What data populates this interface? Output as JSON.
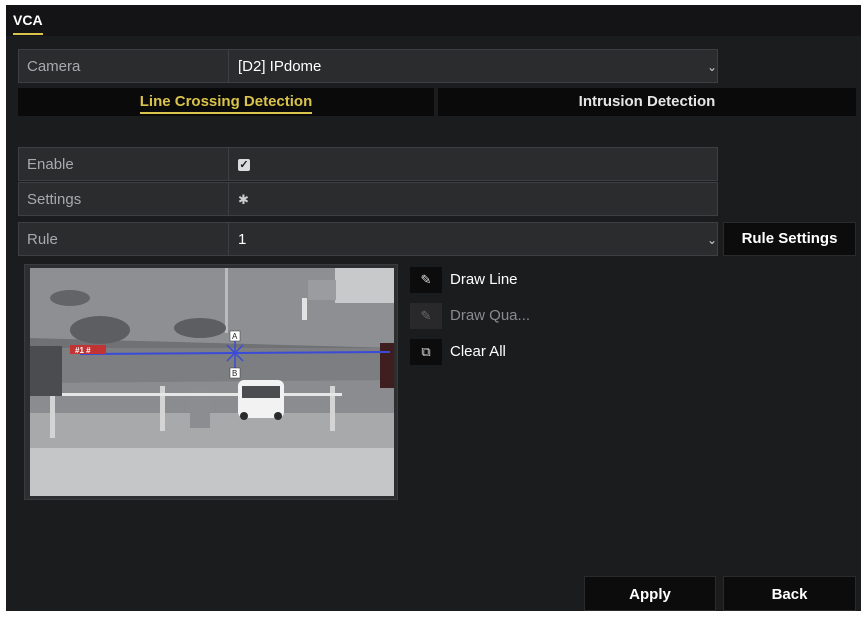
{
  "window": {
    "title": "VCA"
  },
  "camera": {
    "label": "Camera",
    "value": "[D2] IPdome"
  },
  "tabs": [
    {
      "label": "Line Crossing Detection",
      "active": true
    },
    {
      "label": "Intrusion Detection",
      "active": false
    }
  ],
  "enable": {
    "label": "Enable",
    "checked": true
  },
  "settings": {
    "label": "Settings"
  },
  "rule": {
    "label": "Rule",
    "value": "1",
    "settings_button": "Rule Settings"
  },
  "preview": {
    "line_label": "#1 #",
    "arrow_a": "A",
    "arrow_b": "B"
  },
  "tools": {
    "draw_line": "Draw Line",
    "draw_quadrilateral": "Draw Qua...",
    "clear_all": "Clear All"
  },
  "footer": {
    "apply": "Apply",
    "back": "Back"
  },
  "colors": {
    "accent": "#d9c34a",
    "line": "#3a4bd8",
    "background": "#1b1c1e"
  }
}
